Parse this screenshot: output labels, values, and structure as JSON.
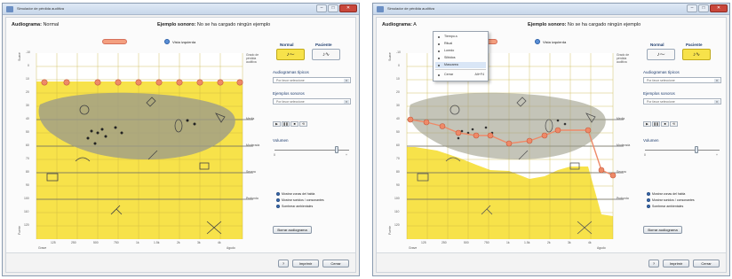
{
  "title": "Simulador de pérdida auditiva",
  "header": {
    "audiogram_label": "Audiograma:",
    "audiogram_value_left": "Normal",
    "audiogram_value_right": "A",
    "example_label": "Ejemplo sonoro:",
    "example_value": "No se ha cargado ningún ejemplo"
  },
  "legend_top": {
    "left_label": "Umbrales",
    "right_label": "Vista izquierda"
  },
  "graph": {
    "y_ticks": [
      "-10",
      "0",
      "10",
      "20",
      "30",
      "40",
      "50",
      "60",
      "70",
      "80",
      "90",
      "100",
      "110",
      "120"
    ],
    "x_ticks": [
      "125",
      "250",
      "500",
      "750",
      "1k",
      "1.5k",
      "2k",
      "3k",
      "4k",
      "6k",
      "8k"
    ],
    "y_top": "Suave",
    "y_bottom": "Fuerte",
    "x_left": "Grave",
    "x_right": "Agudo",
    "right_labels": [
      "Grado de pérdida auditiva",
      "Media",
      "Moderada",
      "Severa",
      "Profunda"
    ],
    "bottom_legend": [
      "Dcho.",
      "Izdo."
    ]
  },
  "right_panel": {
    "normal": "Normal",
    "patient": "Paciente",
    "typical_label": "Audiogramas típicos",
    "typical_value": "Por favor seleccione",
    "examples_label": "Ejemplos sonoros",
    "examples_value": "Por favor seleccione",
    "controls": [
      "▶",
      "❚❚",
      "■",
      "⟲"
    ],
    "volume_label": "Volumen",
    "vol_min": "0",
    "vol_max": "+",
    "checks": [
      "Mostrar zonas del habla",
      "Mostrar sonidos / consonantes",
      "Sombrear ambientales"
    ],
    "reset": "Borrar audiograma"
  },
  "footer": {
    "help": "?",
    "print": "Imprimir",
    "close": "Cerrar"
  },
  "menu": {
    "items": [
      "Tiempo-s",
      "Ritual",
      "Loredo",
      "Silbidos",
      "Mascarea",
      "Cerrar"
    ],
    "accel": "Alt+F4"
  },
  "curve_right": {
    "points_db": [
      40,
      42,
      45,
      50,
      52,
      52,
      58,
      56,
      52,
      48,
      48,
      78,
      82
    ],
    "freq_positions": [
      "125",
      "250",
      "500",
      "750",
      "1k",
      "1.5k",
      "2k",
      "3k",
      "4k",
      "6k",
      "8k",
      "8k+",
      "8k++"
    ]
  },
  "colors": {
    "yellow": "#f7e24a",
    "banana": "#9c9c88",
    "curve": "#ee8a68",
    "grid": "#c9b545"
  }
}
